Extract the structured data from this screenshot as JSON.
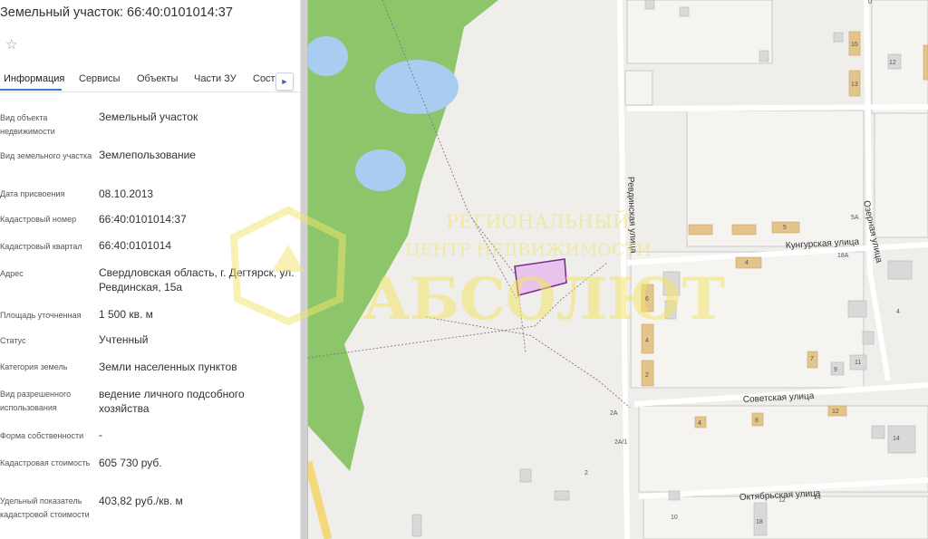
{
  "panel": {
    "title": "Земельный участок: 66:40:0101014:37",
    "star_icon": "☆",
    "tabs": [
      "Информация",
      "Сервисы",
      "Объекты",
      "Части ЗУ",
      "Соста"
    ],
    "tab_next_icon": "►",
    "rows": [
      {
        "label": "Вид объекта недвижимости",
        "value": "Земельный участок"
      },
      {
        "label": "Вид земельного участка",
        "value": "Землепользование"
      },
      {
        "label": "Дата присвоения",
        "value": "08.10.2013"
      },
      {
        "label": "Кадастровый номер",
        "value": "66:40:0101014:37"
      },
      {
        "label": "Кадастровый квартал",
        "value": "66:40:0101014"
      },
      {
        "label": "Адрес",
        "value": "Свердловская область, г. Дегтярск, ул. Ревдинская, 15а"
      },
      {
        "label": "Площадь уточненная",
        "value": "1 500 кв. м"
      },
      {
        "label": "Статус",
        "value": "Учтенный"
      },
      {
        "label": "Категория земель",
        "value": "Земли населенных пунктов"
      },
      {
        "label": "Вид разрешенного использования",
        "value": "ведение личного подсобного хозяйства"
      },
      {
        "label": "Форма собственности",
        "value": "-"
      },
      {
        "label": "Кадастровая стоимость",
        "value": "605 730 руб."
      },
      {
        "label": "Удельный показатель кадастровой стоимости",
        "value": "403,82 руб./кв. м"
      }
    ]
  },
  "map": {
    "streets": {
      "revdinskaya": "Ревдинская улица",
      "kungurskaya": "Кунгурская улица",
      "ozernaya": "Озерная улица",
      "sovetskaya": "Советская улица",
      "oktyabrskaya": "Октябрьская улица"
    },
    "house_numbers": [
      "15",
      "13",
      "12",
      "5A",
      "5",
      "4",
      "6",
      "4",
      "2",
      "18A",
      "4",
      "7",
      "9",
      "11",
      "2A",
      "2A/1",
      "12",
      "4",
      "8",
      "14",
      "12",
      "14",
      "18",
      "2",
      "10",
      "0"
    ],
    "watermark": {
      "line1": "РЕГИОНАЛЬНЫЙ",
      "line2": "ЦЕНТР НЕДВИЖИМОСТИ",
      "brand": "АБСОЛЮТ"
    },
    "colors": {
      "forest": "#8dc66a",
      "water": "#a9cdf0",
      "parcel": "#e8c3ec",
      "parcel_border": "#7a2f8a",
      "building": "#e3c48a"
    }
  }
}
